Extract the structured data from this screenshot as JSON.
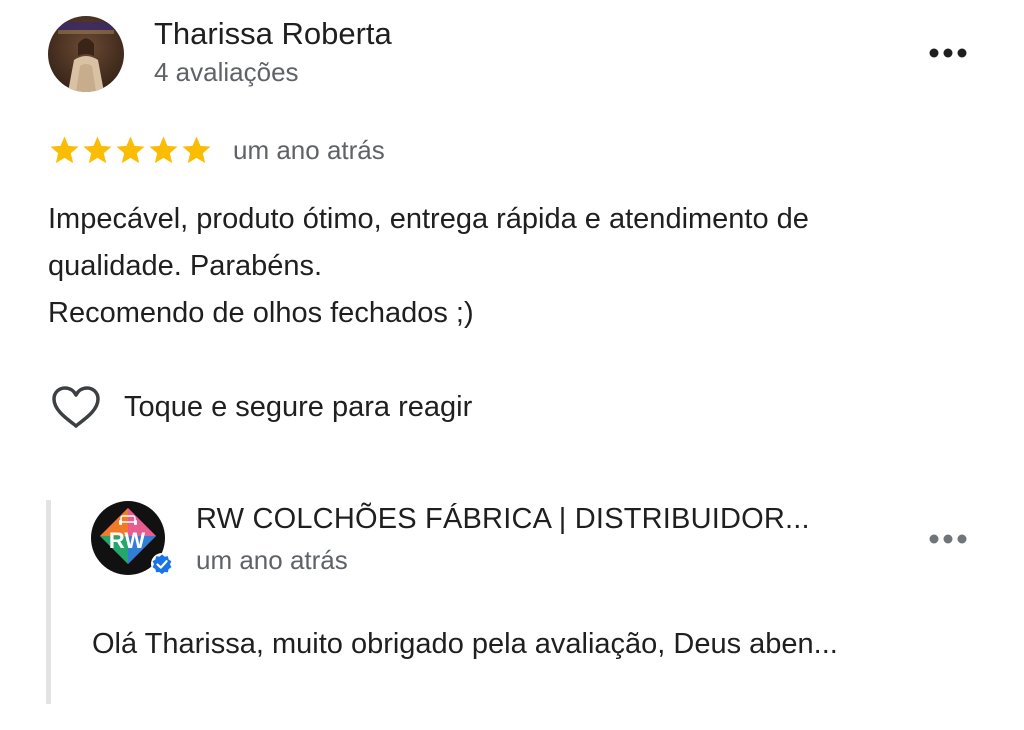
{
  "review": {
    "author": {
      "name": "Tharissa Roberta",
      "review_count": "4 avaliações",
      "avatar_icon": "user-photo"
    },
    "rating": 5,
    "rating_max": 5,
    "star_color": "#fbbc04",
    "date": "um ano atrás",
    "text_lines": [
      "Impecável, produto ótimo, entrega rápida e atendimento de",
      "qualidade. Parabéns.",
      "Recomendo de olhos fechados ;)"
    ],
    "react_label": "Toque e segure para reagir",
    "more_icon": "more-horizontal-icon"
  },
  "owner_reply": {
    "owner_name": "RW COLCHÕES FÁBRICA | DISTRIBUIDOR...",
    "logo_text": "RW",
    "verified_badge_color": "#1a73e8",
    "date": "um ano atrás",
    "text": "Olá Tharissa, muito obrigado pela avaliação, Deus aben...",
    "more_icon": "more-horizontal-icon"
  }
}
